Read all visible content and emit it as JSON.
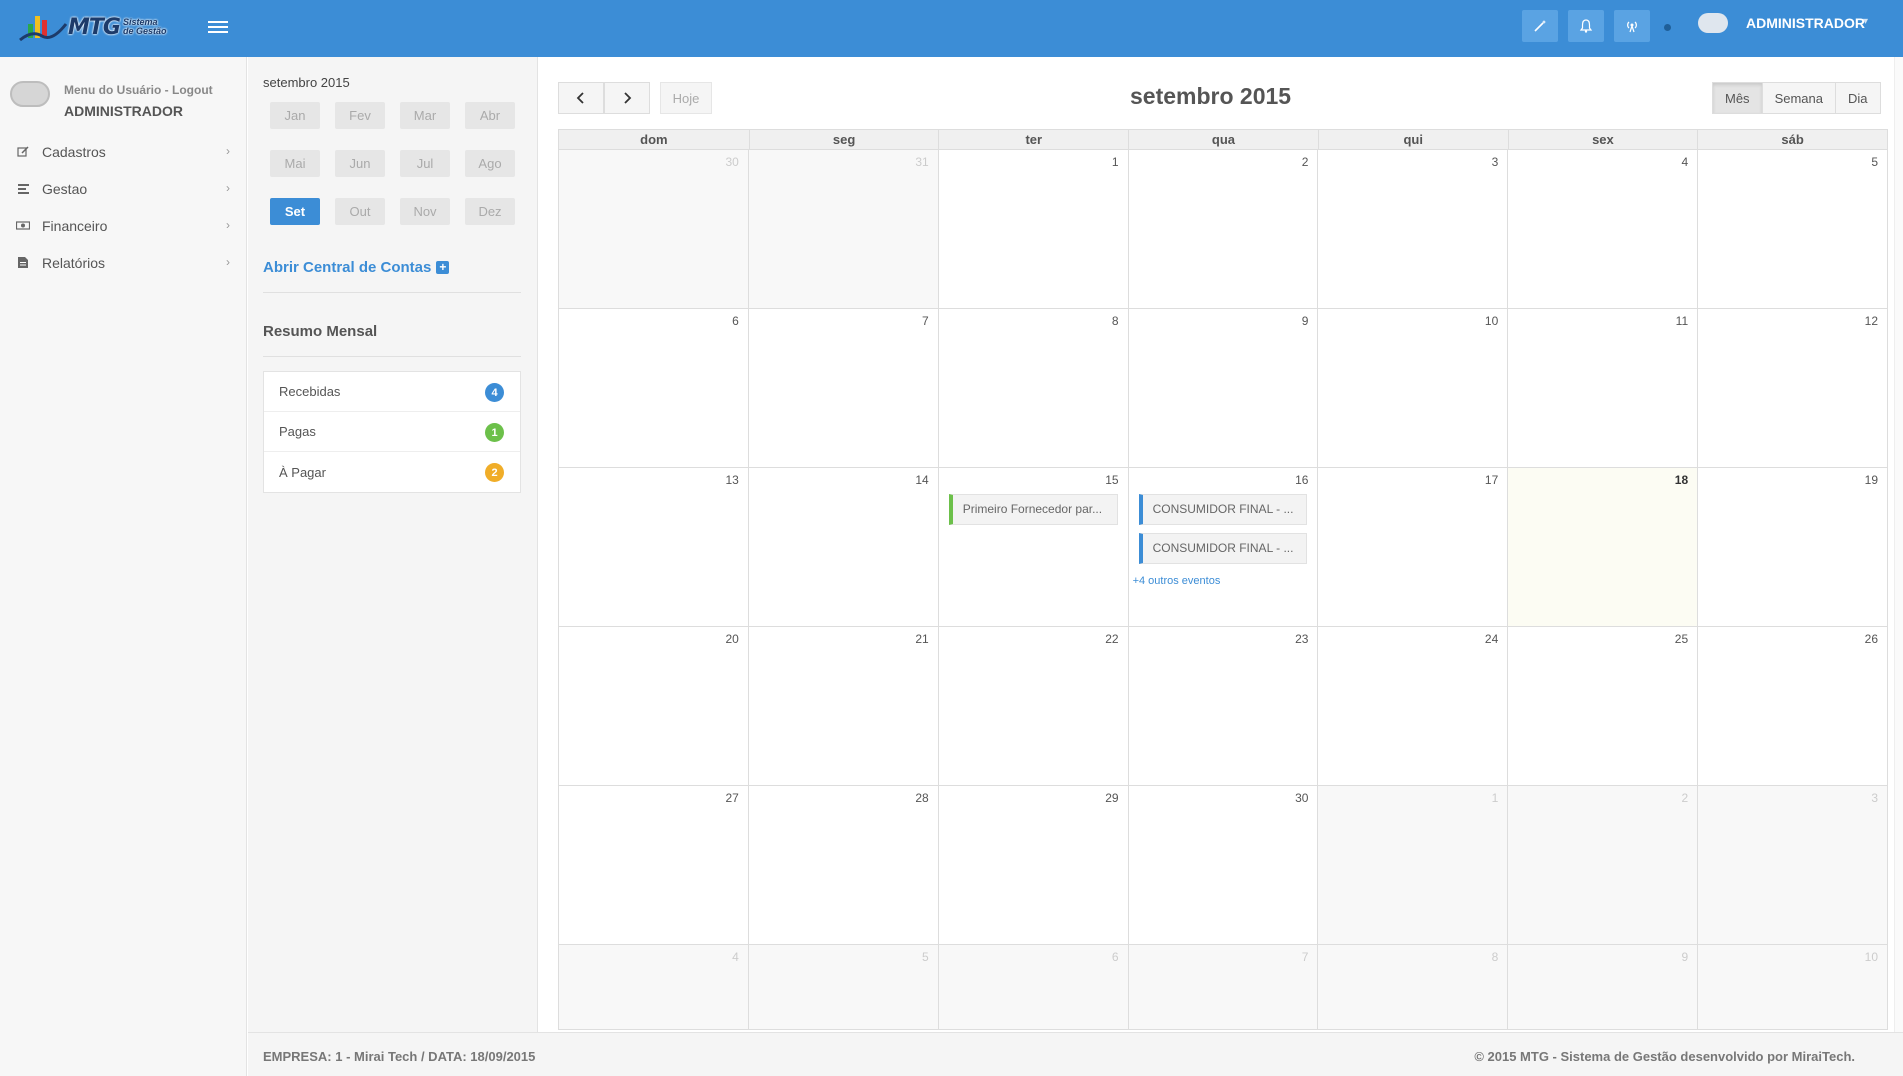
{
  "header": {
    "logo_text": "MTG",
    "logo_sub_1": "Sistema",
    "logo_sub_2": "de Gestão",
    "user_name": "ADMINISTRADOR",
    "icons": [
      "magic-wand-icon",
      "bell-icon",
      "broadcast-icon"
    ]
  },
  "sidebar": {
    "user_menu_label": "Menu do Usuário - Logout",
    "user_name": "ADMINISTRADOR",
    "items": [
      {
        "label": "Cadastros",
        "icon": "edit-icon"
      },
      {
        "label": "Gestao",
        "icon": "list-icon"
      },
      {
        "label": "Financeiro",
        "icon": "money-icon"
      },
      {
        "label": "Relatórios",
        "icon": "document-icon"
      }
    ]
  },
  "panel": {
    "year_label": "setembro 2015",
    "months": [
      "Jan",
      "Fev",
      "Mar",
      "Abr",
      "Mai",
      "Jun",
      "Jul",
      "Ago",
      "Set",
      "Out",
      "Nov",
      "Dez"
    ],
    "active_month": "Set",
    "open_accounts_label": "Abrir Central de Contas",
    "summary_title": "Resumo Mensal",
    "summary": [
      {
        "label": "Recebidas",
        "count": "4",
        "color": "#3c8dd6"
      },
      {
        "label": "Pagas",
        "count": "1",
        "color": "#6cc04a"
      },
      {
        "label": "À Pagar",
        "count": "2",
        "color": "#f0ad28"
      }
    ]
  },
  "calendar": {
    "title": "setembro 2015",
    "today_label": "Hoje",
    "views": [
      "Mês",
      "Semana",
      "Dia"
    ],
    "active_view": "Mês",
    "weekdays": [
      "dom",
      "seg",
      "ter",
      "qua",
      "qui",
      "sex",
      "sáb"
    ],
    "weeks": [
      [
        {
          "d": "30",
          "o": true
        },
        {
          "d": "31",
          "o": true
        },
        {
          "d": "1"
        },
        {
          "d": "2"
        },
        {
          "d": "3"
        },
        {
          "d": "4"
        },
        {
          "d": "5"
        }
      ],
      [
        {
          "d": "6"
        },
        {
          "d": "7"
        },
        {
          "d": "8"
        },
        {
          "d": "9"
        },
        {
          "d": "10"
        },
        {
          "d": "11"
        },
        {
          "d": "12"
        }
      ],
      [
        {
          "d": "13"
        },
        {
          "d": "14"
        },
        {
          "d": "15",
          "events": [
            {
              "label": "Primeiro Fornecedor par...",
              "color": "green"
            }
          ]
        },
        {
          "d": "16",
          "events": [
            {
              "label": "CONSUMIDOR FINAL - ...",
              "color": "blue"
            },
            {
              "label": "CONSUMIDOR FINAL - ...",
              "color": "blue"
            }
          ],
          "more": "+4 outros eventos"
        },
        {
          "d": "17"
        },
        {
          "d": "18",
          "today": true
        },
        {
          "d": "19"
        }
      ],
      [
        {
          "d": "20"
        },
        {
          "d": "21"
        },
        {
          "d": "22"
        },
        {
          "d": "23"
        },
        {
          "d": "24"
        },
        {
          "d": "25"
        },
        {
          "d": "26"
        }
      ],
      [
        {
          "d": "27"
        },
        {
          "d": "28"
        },
        {
          "d": "29"
        },
        {
          "d": "30"
        },
        {
          "d": "1",
          "o": true
        },
        {
          "d": "2",
          "o": true
        },
        {
          "d": "3",
          "o": true
        }
      ],
      [
        {
          "d": "4",
          "o": true
        },
        {
          "d": "5",
          "o": true
        },
        {
          "d": "6",
          "o": true
        },
        {
          "d": "7",
          "o": true
        },
        {
          "d": "8",
          "o": true
        },
        {
          "d": "9",
          "o": true
        },
        {
          "d": "10",
          "o": true
        }
      ]
    ]
  },
  "footer": {
    "left": "EMPRESA: 1 - Mirai Tech / DATA: 18/09/2015",
    "right": "© 2015 MTG - Sistema de Gestão desenvolvido por MiraiTech."
  }
}
